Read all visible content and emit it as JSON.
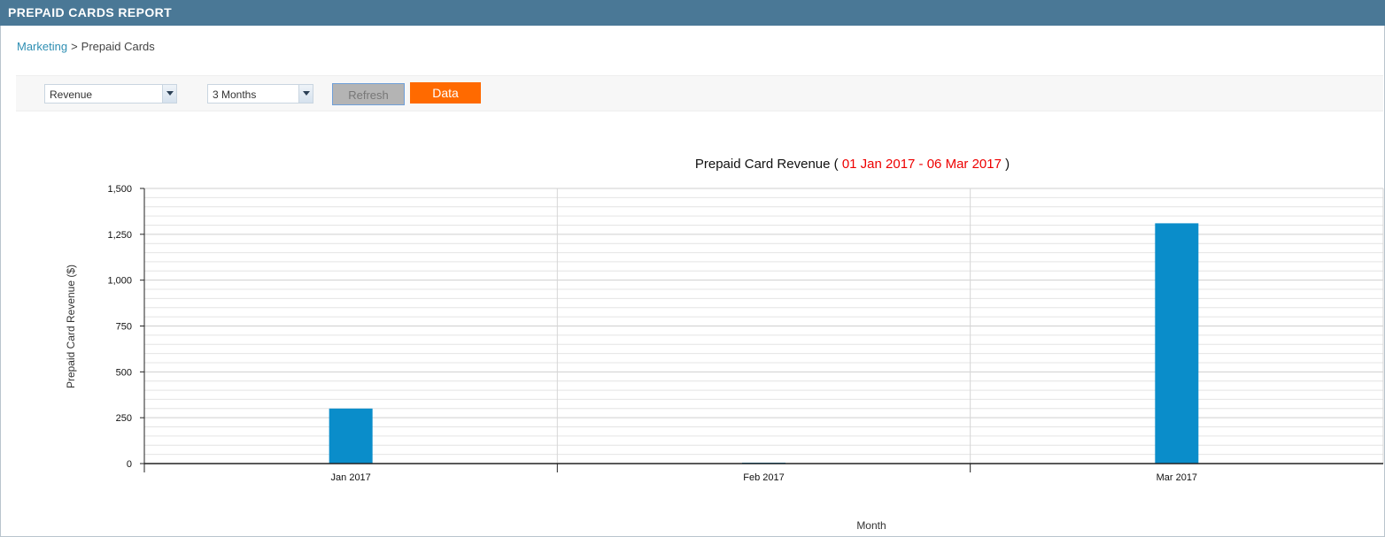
{
  "header": {
    "title": "PREPAID CARDS REPORT"
  },
  "breadcrumb": {
    "link": "Marketing",
    "separator": ">",
    "current": "Prepaid Cards"
  },
  "toolbar": {
    "metric_select": {
      "value": "Revenue"
    },
    "period_select": {
      "value": "3 Months"
    },
    "refresh_label": "Refresh",
    "data_label": "Data"
  },
  "chart_title": {
    "text": "Prepaid Card Revenue",
    "open": "(",
    "range": "01 Jan 2017 - 06 Mar 2017",
    "close": ")"
  },
  "colors": {
    "header_bg": "#4a7896",
    "bar": "#0a8dca",
    "data_button": "#ff6a00",
    "range_text": "#ee0000",
    "link": "#2f8fb3"
  },
  "chart_data": {
    "type": "bar",
    "categories": [
      "Jan 2017",
      "Feb 2017",
      "Mar 2017"
    ],
    "values": [
      300,
      5,
      1310
    ],
    "xlabel": "Month",
    "ylabel": "Prepaid Card Revenue ($)",
    "ylim": [
      0,
      1500
    ],
    "yticks": [
      0,
      250,
      500,
      750,
      1000,
      1250,
      1500
    ],
    "ytick_labels": [
      "0",
      "250",
      "500",
      "750",
      "1,000",
      "1,250",
      "1,500"
    ],
    "grid": true
  }
}
